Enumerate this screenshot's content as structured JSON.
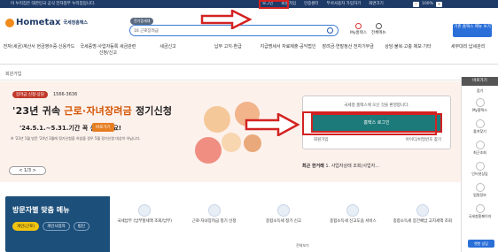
{
  "topbar": {
    "gov_notice": "이 누리집은 대한민국 공식 전자정부 누리집입니다.",
    "links": [
      "로그인",
      "회원가입",
      "인증센터",
      "부서사용자 가입하기",
      "화면크기"
    ],
    "zoom": "100%"
  },
  "header": {
    "logo_text": "Hometax",
    "logo_name": "국세청홈택스",
    "search_tag": "전기증세대",
    "search_prefix": "16 근로장려금",
    "search_placeholder": "",
    "my_label": "My홈택스",
    "menu_label": "전체메뉴",
    "basic_btn": "기존 홈택스 메뉴 보기"
  },
  "nav": [
    "전자(세금)계산서 현금영수증·신용카드",
    "국세증명·사업자등록 세금관련 신청/신고",
    "세금신고",
    "납부 고지·환급",
    "지급명세서 자료제출·공익법인",
    "장려금·연말정산 전자기부금",
    "상담·불복·고충 제보·기타",
    "세무대리 납세관리"
  ],
  "sub": {
    "home": "회원가입"
  },
  "hero": {
    "pill": "장려금 신청·상담",
    "phone": "1566-3636",
    "title_pre": "'23년 귀속 ",
    "title_em": "근로·자녀장려금",
    "title_post": " 정기신청",
    "dates": "'24.5.1.~5.31.기간 꼭 신청하세요!",
    "more": "바로가기",
    "note": "※ '23년 1월 방문 '24년 3월에 정기신청을 하셨을 경우 5월 정기신청 대상이 아닙니다.",
    "pager": "< 1/3 >"
  },
  "login": {
    "welcome": "국세청 홈택스에 오신 것을 환영합니다.",
    "button": "홈택스 로그인",
    "opt_left": "회원가입",
    "opt_right": "아이디/비밀번호 찾기"
  },
  "recent": {
    "label": "최근 한거래",
    "value": "1. 사업자상태 조회(사업자..."
  },
  "bottom": {
    "title": "방문자별 맞춤 메뉴",
    "tabs": [
      "개인(근로)",
      "개인사업자",
      "법인"
    ],
    "cards": [
      "국세납부 (납부할세액 조회/납부)",
      "근로·자녀장려금 정기 신청",
      "종합소득세 정기 신고",
      "종합소득세 신고도움 서비스",
      "종합소득세 증간예납 고지세액 조회"
    ],
    "all_view": "전체보기"
  },
  "sidebar": {
    "header": "바로가기",
    "items": [
      "접기",
      "My홈택스",
      "즐겨찾기",
      "최근조회",
      "인터넷상담",
      "법령정보",
      "국세청홈페이지"
    ],
    "chat": "챗봇 상담"
  }
}
